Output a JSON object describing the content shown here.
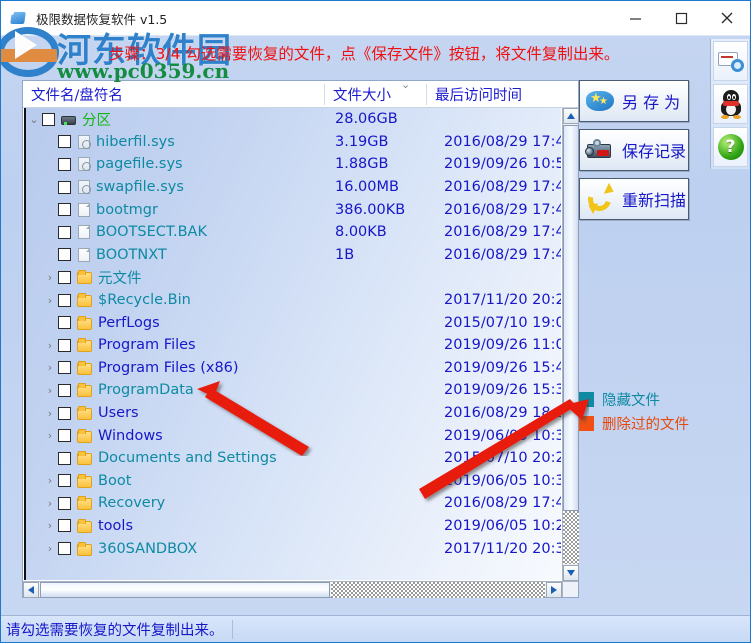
{
  "window": {
    "title": "极限数据恢复软件 v1.5",
    "app_icon": "app-icon",
    "minimize": "—",
    "maximize": "□",
    "close": "✕"
  },
  "watermark": {
    "site_name": "河东软件园",
    "url": "www.pc0359.cn"
  },
  "instruction": "步骤：3/4 勾选需要恢复的文件，点《保存文件》按钮，将文件复制出来。",
  "list": {
    "columns": [
      "文件名/盘符名",
      "文件大小",
      "最后访问时间"
    ],
    "sort_indicator": "⌄",
    "rows": [
      {
        "indent": 0,
        "twisty": "⌄",
        "icon": "drive-icon",
        "name": "分区",
        "color": "green",
        "size": "28.06GB",
        "time": ""
      },
      {
        "indent": 1,
        "twisty": "",
        "icon": "system-file-icon",
        "name": "hiberfil.sys",
        "color": "hidden",
        "size": "3.19GB",
        "time": "2016/08/29 17:4"
      },
      {
        "indent": 1,
        "twisty": "",
        "icon": "system-file-icon",
        "name": "pagefile.sys",
        "color": "hidden",
        "size": "1.88GB",
        "time": "2019/09/26 10:5"
      },
      {
        "indent": 1,
        "twisty": "",
        "icon": "system-file-icon",
        "name": "swapfile.sys",
        "color": "hidden",
        "size": "16.00MB",
        "time": "2016/08/29 17:4"
      },
      {
        "indent": 1,
        "twisty": "",
        "icon": "file-icon",
        "name": "bootmgr",
        "color": "hidden",
        "size": "386.00KB",
        "time": "2016/08/29 17:4"
      },
      {
        "indent": 1,
        "twisty": "",
        "icon": "file-icon",
        "name": "BOOTSECT.BAK",
        "color": "hidden",
        "size": "8.00KB",
        "time": "2016/08/29 17:4"
      },
      {
        "indent": 1,
        "twisty": "",
        "icon": "file-icon",
        "name": "BOOTNXT",
        "color": "hidden",
        "size": "1B",
        "time": "2016/08/29 17:4"
      },
      {
        "indent": 1,
        "twisty": "›",
        "icon": "folder-icon",
        "name": "元文件",
        "color": "hidden",
        "size": "",
        "time": ""
      },
      {
        "indent": 1,
        "twisty": "›",
        "icon": "folder-icon",
        "name": "$Recycle.Bin",
        "color": "hidden",
        "size": "",
        "time": "2017/11/20 20:2"
      },
      {
        "indent": 1,
        "twisty": "",
        "icon": "folder-icon",
        "name": "PerfLogs",
        "color": "normal",
        "size": "",
        "time": "2015/07/10 19:0"
      },
      {
        "indent": 1,
        "twisty": "›",
        "icon": "folder-icon",
        "name": "Program Files",
        "color": "normal",
        "size": "",
        "time": "2019/09/26 11:0"
      },
      {
        "indent": 1,
        "twisty": "›",
        "icon": "folder-icon",
        "name": "Program Files (x86)",
        "color": "normal",
        "size": "",
        "time": "2019/09/26 15:4"
      },
      {
        "indent": 1,
        "twisty": "›",
        "icon": "folder-icon",
        "name": "ProgramData",
        "color": "hidden",
        "size": "",
        "time": "2019/09/26 15:3"
      },
      {
        "indent": 1,
        "twisty": "›",
        "icon": "folder-icon",
        "name": "Users",
        "color": "normal",
        "size": "",
        "time": "2016/08/29 18:2"
      },
      {
        "indent": 1,
        "twisty": "›",
        "icon": "folder-icon",
        "name": "Windows",
        "color": "normal",
        "size": "",
        "time": "2019/06/05 10:3"
      },
      {
        "indent": 1,
        "twisty": "",
        "icon": "folder-icon",
        "name": "Documents and Settings",
        "color": "hidden",
        "size": "",
        "time": "2015/07/10 20:2"
      },
      {
        "indent": 1,
        "twisty": "›",
        "icon": "folder-icon",
        "name": "Boot",
        "color": "hidden",
        "size": "",
        "time": "2019/06/05 10:3"
      },
      {
        "indent": 1,
        "twisty": "›",
        "icon": "folder-icon",
        "name": "Recovery",
        "color": "hidden",
        "size": "",
        "time": "2016/08/29 17:4"
      },
      {
        "indent": 1,
        "twisty": "›",
        "icon": "folder-icon",
        "name": "tools",
        "color": "normal",
        "size": "",
        "time": "2019/06/05 10:2"
      },
      {
        "indent": 1,
        "twisty": "›",
        "icon": "folder-icon",
        "name": "360SANDBOX",
        "color": "hidden",
        "size": "",
        "time": "2017/11/20 20:3"
      }
    ]
  },
  "actions": [
    {
      "id": "save-as",
      "label": "另 存 为",
      "icon": "save-as-icon"
    },
    {
      "id": "save-record",
      "label": "保存记录",
      "icon": "camcorder-icon"
    },
    {
      "id": "rescan",
      "label": "重新扫描",
      "icon": "refresh-icon"
    }
  ],
  "legend": [
    {
      "id": "hidden",
      "label": "隐藏文件",
      "color": "#0e8aa3"
    },
    {
      "id": "deleted",
      "label": "删除过的文件",
      "color": "#f15012"
    }
  ],
  "dock": [
    {
      "id": "settings",
      "icon": "settings-icon"
    },
    {
      "id": "qq",
      "icon": "qq-penguin-icon"
    },
    {
      "id": "help",
      "icon": "help-icon",
      "glyph": "?"
    }
  ],
  "statusbar": {
    "text": "请勾选需要恢复的文件复制出来。"
  },
  "colors": {
    "normal_file": "#1717c8",
    "hidden_file": "#0e8aa3",
    "deleted_file": "#f15012",
    "partition": "#16b516",
    "instruction": "#f01010",
    "accent": "#1b79d0"
  }
}
